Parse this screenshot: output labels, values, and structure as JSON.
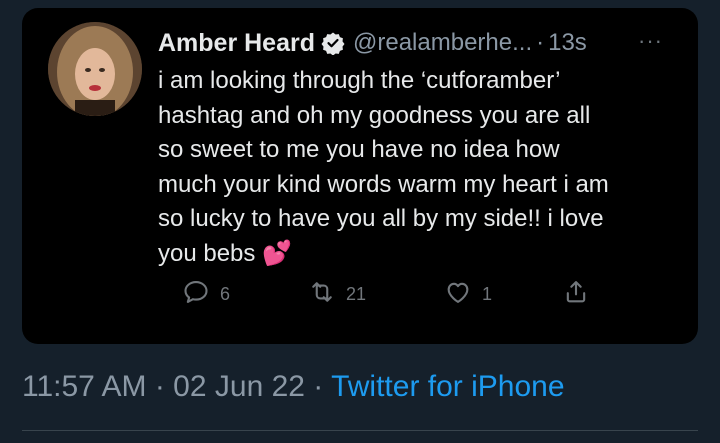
{
  "tweet": {
    "author_name": "Amber Heard",
    "handle": "@realamberhe...",
    "separator": "·",
    "time_ago": "13s",
    "more_glyph": "···",
    "text": "i am looking through the ‘cutforamber’\nhashtag and oh my goodness you are all\nso sweet to me you have no idea how\nmuch your kind words warm my heart i am\nso lucky to have you all by my side!! i love\nyou bebs",
    "emoji": "💕",
    "actions": {
      "reply_count": "6",
      "retweet_count": "21",
      "like_count": "1"
    }
  },
  "footer": {
    "timestamp": "11:57 AM · 02 Jun 22 ·",
    "source": "Twitter for iPhone"
  },
  "colors": {
    "background": "#15202b",
    "card": "#000000",
    "text": "#e7e9ea",
    "muted": "#8b98a5",
    "link": "#1d9bf0"
  },
  "icons": [
    "verified-badge-icon",
    "more-icon",
    "reply-icon",
    "retweet-icon",
    "like-icon",
    "share-icon"
  ]
}
